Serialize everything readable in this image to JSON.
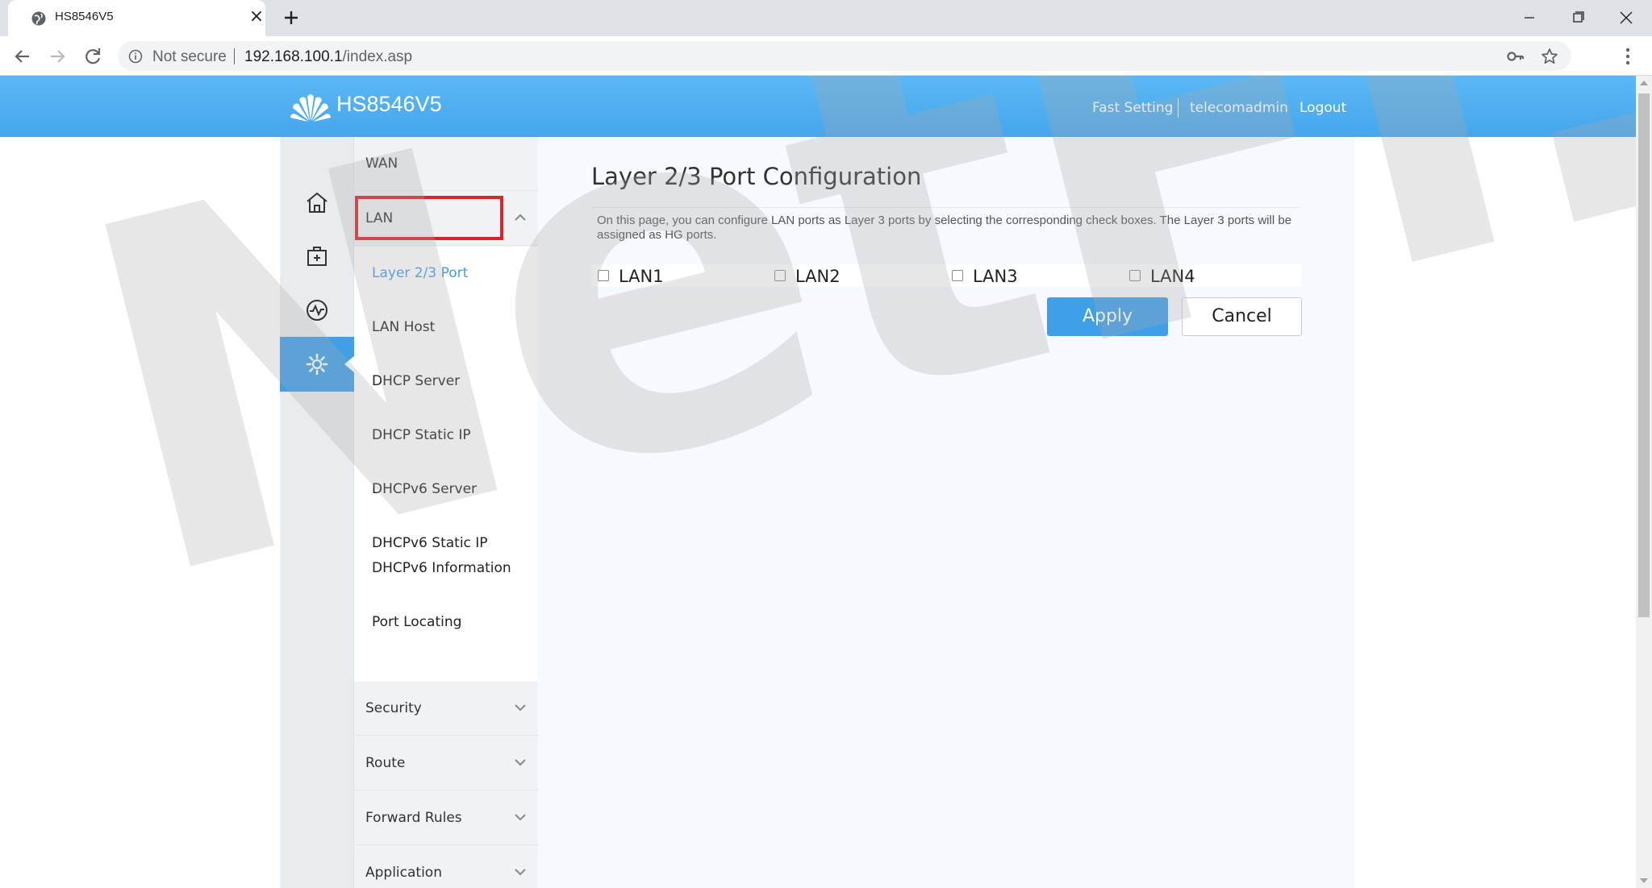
{
  "browser": {
    "tab_title": "HS8546V5",
    "tab_close": "×",
    "security_label": "Not secure",
    "url_host": "192.168.100.1",
    "url_path": "/index.asp"
  },
  "header": {
    "brand": "HS8546V5",
    "links": {
      "fast_setting": "Fast Setting",
      "user": "telecomadmin",
      "logout": "Logout"
    }
  },
  "rail": {
    "items": [
      {
        "icon": "home-icon"
      },
      {
        "icon": "toolbox-icon"
      },
      {
        "icon": "diagnose-icon"
      },
      {
        "icon": "gear-icon",
        "active": true
      }
    ]
  },
  "menu": {
    "groups": {
      "wan": "WAN",
      "lan": "LAN",
      "security": "Security",
      "route": "Route",
      "forward_rules": "Forward Rules",
      "application": "Application"
    },
    "lan_items": [
      "Layer 2/3 Port",
      "LAN Host",
      "DHCP Server",
      "DHCP Static IP",
      "DHCPv6 Server",
      "DHCPv6 Static IP",
      "DHCPv6 Information",
      "Port Locating"
    ],
    "active_item": "Layer 2/3 Port"
  },
  "content": {
    "title": "Layer 2/3 Port Configuration",
    "description": "On this page, you can configure LAN ports as Layer 3 ports by selecting the corresponding check boxes. The Layer 3 ports will be assigned as HG ports.",
    "ports": [
      {
        "label": "LAN1",
        "checked": false
      },
      {
        "label": "LAN2",
        "checked": false
      },
      {
        "label": "LAN3",
        "checked": false
      },
      {
        "label": "LAN4",
        "checked": false
      }
    ],
    "apply_label": "Apply",
    "cancel_label": "Cancel"
  },
  "watermark": "NetFi.ir",
  "colors": {
    "header_blue": "#46a6ec",
    "accent": "#3fa0e8",
    "highlight_red": "#d9252a"
  }
}
